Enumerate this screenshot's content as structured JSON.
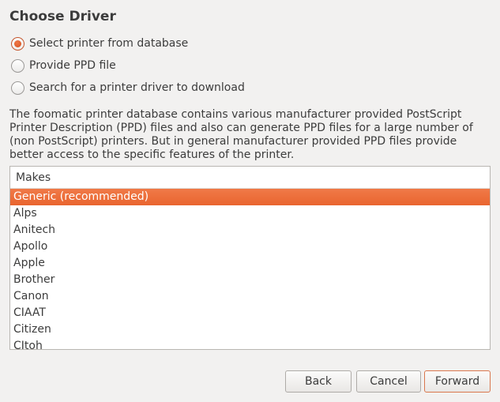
{
  "title": "Choose Driver",
  "options": [
    {
      "label": "Select printer from database",
      "checked": true
    },
    {
      "label": "Provide PPD file",
      "checked": false
    },
    {
      "label": "Search for a printer driver to download",
      "checked": false
    }
  ],
  "description": "The foomatic printer database contains various manufacturer provided PostScript Printer Description (PPD) files and also can generate PPD files for a large number of (non PostScript) printers. But in general manufacturer provided PPD files provide better access to the specific features of the printer.",
  "makes": {
    "header": "Makes",
    "items": [
      "Generic (recommended)",
      "Alps",
      "Anitech",
      "Apollo",
      "Apple",
      "Brother",
      "Canon",
      "CIAAT",
      "Citizen",
      "CItoh"
    ],
    "selected": "Generic (recommended)"
  },
  "buttons": {
    "back": "Back",
    "cancel": "Cancel",
    "forward": "Forward"
  },
  "colors": {
    "accent": "#e9652f",
    "window_bg": "#f2f1f0"
  }
}
